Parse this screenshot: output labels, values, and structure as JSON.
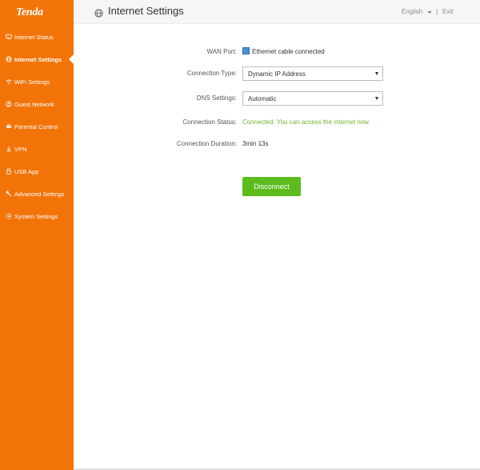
{
  "brand": {
    "logo_text": "Tenda",
    "accent": "#f27409"
  },
  "sidebar": {
    "items": [
      {
        "label": "Internet Status",
        "icon": "monitor-icon"
      },
      {
        "label": "Internet Settings",
        "icon": "globe-icon",
        "active": true
      },
      {
        "label": "WiFi Settings",
        "icon": "wifi-icon"
      },
      {
        "label": "Guest Network",
        "icon": "guest-network-icon"
      },
      {
        "label": "Parental Control",
        "icon": "parental-control-icon"
      },
      {
        "label": "VPN",
        "icon": "vpn-icon"
      },
      {
        "label": "USB App",
        "icon": "usb-icon"
      },
      {
        "label": "Advanced Settings",
        "icon": "wrench-icon"
      },
      {
        "label": "System Settings",
        "icon": "gear-icon"
      }
    ]
  },
  "header": {
    "title": "Internet Settings",
    "language": "English",
    "divider": "|",
    "exit_label": "Exit"
  },
  "form": {
    "wan_port": {
      "label": "WAN Port:",
      "value": "Ethernet cable connected"
    },
    "connection_type": {
      "label": "Connection Type:",
      "value": "Dynamic IP Address"
    },
    "dns_settings": {
      "label": "DNS Settings:",
      "value": "Automatic"
    },
    "connection_status": {
      "label": "Connection Status:",
      "value": "Connected. You can access the internet now."
    },
    "connection_duration": {
      "label": "Connection Duration:",
      "value": "3min 13s"
    }
  },
  "actions": {
    "disconnect_label": "Disconnect",
    "button_color": "#5dbb1e"
  },
  "colors": {
    "status_ok": "#6fb72b"
  }
}
